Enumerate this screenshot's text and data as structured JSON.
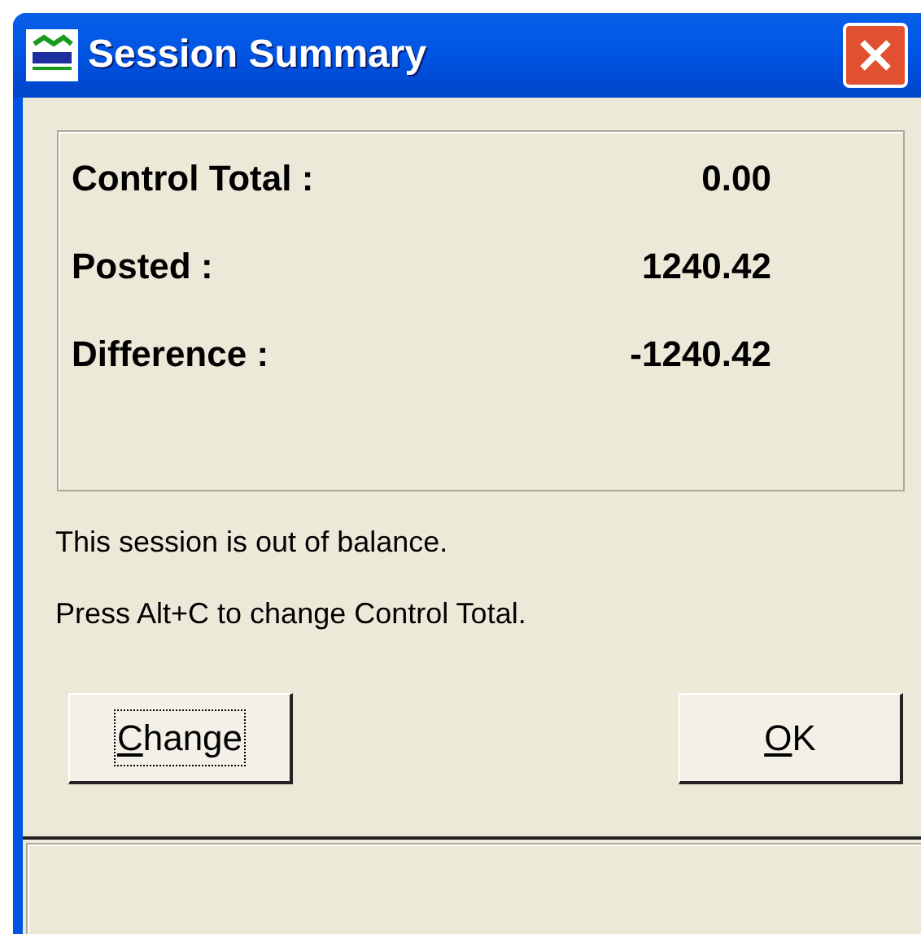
{
  "window": {
    "title": "Session Summary"
  },
  "summary": [
    {
      "label": "Control Total :",
      "value": "0.00"
    },
    {
      "label": "Posted :",
      "value": "1240.42"
    },
    {
      "label": "Difference :",
      "value": "-1240.42"
    }
  ],
  "messages": [
    "This session is out of balance.",
    "Press Alt+C to change Control Total."
  ],
  "buttons": [
    {
      "label": "Change",
      "focused": true,
      "access_key_underlined": true
    },
    {
      "label": "OK",
      "focused": false,
      "access_key_underlined": true
    }
  ]
}
